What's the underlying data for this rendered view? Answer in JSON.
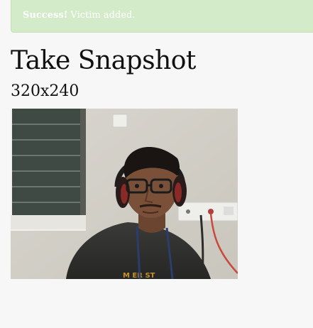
{
  "alert": {
    "strong_text": "Success!",
    "message": " Victim added."
  },
  "page": {
    "title": "Take Snapshot",
    "resolution": "320x240"
  },
  "snapshot": {
    "description_icon": "camera-snapshot-image"
  }
}
